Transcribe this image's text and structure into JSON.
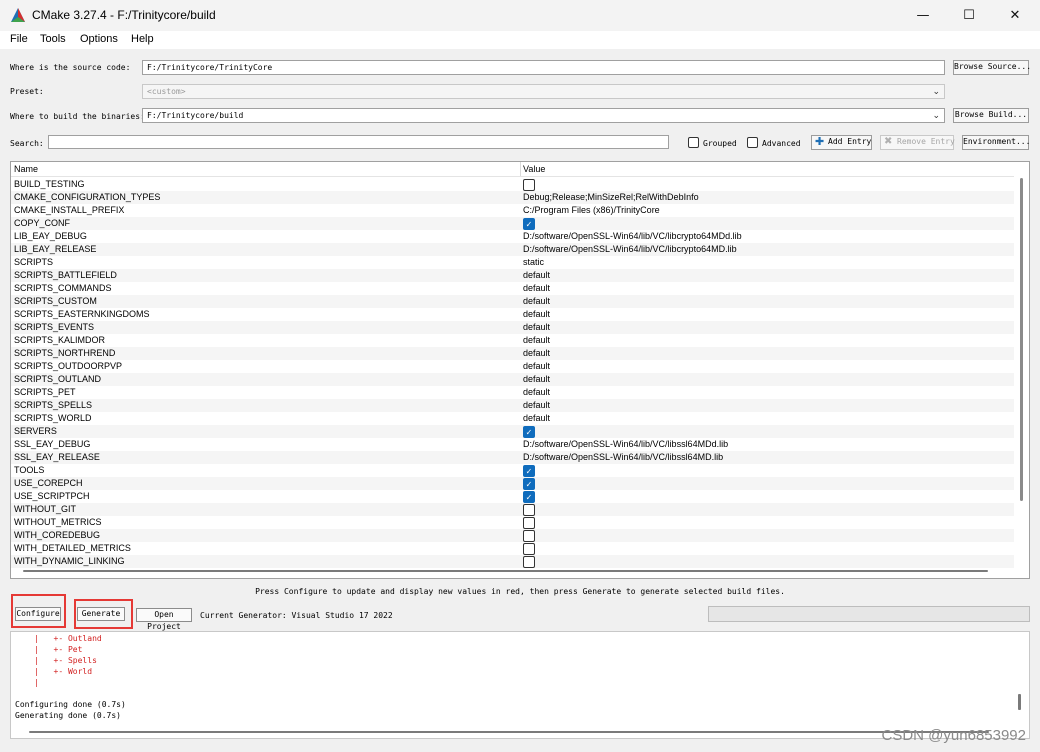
{
  "window": {
    "title": "CMake 3.27.4 - F:/Trinitycore/build",
    "minimize": "—",
    "maximize": "☐",
    "close": "✕"
  },
  "menu": [
    "File",
    "Tools",
    "Options",
    "Help"
  ],
  "source": {
    "label": "Where is the source code:",
    "value": "F:/Trinitycore/TrinityCore",
    "browse": "Browse Source..."
  },
  "preset": {
    "label": "Preset:",
    "value": "<custom>"
  },
  "binaries": {
    "label": "Where to build the binaries:",
    "value": "F:/Trinitycore/build",
    "browse": "Browse Build..."
  },
  "search": {
    "label": "Search:",
    "value": "",
    "grouped": "Grouped",
    "advanced": "Advanced",
    "add_entry": "Add Entry",
    "remove_entry": "Remove Entry",
    "environment": "Environment..."
  },
  "table": {
    "columns": [
      "Name",
      "Value"
    ],
    "rows": [
      {
        "name": "BUILD_TESTING",
        "type": "bool",
        "checked": false
      },
      {
        "name": "CMAKE_CONFIGURATION_TYPES",
        "type": "text",
        "value": "Debug;Release;MinSizeRel;RelWithDebInfo"
      },
      {
        "name": "CMAKE_INSTALL_PREFIX",
        "type": "text",
        "value": "C:/Program Files (x86)/TrinityCore"
      },
      {
        "name": "COPY_CONF",
        "type": "bool",
        "checked": true
      },
      {
        "name": "LIB_EAY_DEBUG",
        "type": "text",
        "value": "D:/software/OpenSSL-Win64/lib/VC/libcrypto64MDd.lib"
      },
      {
        "name": "LIB_EAY_RELEASE",
        "type": "text",
        "value": "D:/software/OpenSSL-Win64/lib/VC/libcrypto64MD.lib"
      },
      {
        "name": "SCRIPTS",
        "type": "text",
        "value": "static"
      },
      {
        "name": "SCRIPTS_BATTLEFIELD",
        "type": "text",
        "value": "default"
      },
      {
        "name": "SCRIPTS_COMMANDS",
        "type": "text",
        "value": "default"
      },
      {
        "name": "SCRIPTS_CUSTOM",
        "type": "text",
        "value": "default"
      },
      {
        "name": "SCRIPTS_EASTERNKINGDOMS",
        "type": "text",
        "value": "default"
      },
      {
        "name": "SCRIPTS_EVENTS",
        "type": "text",
        "value": "default"
      },
      {
        "name": "SCRIPTS_KALIMDOR",
        "type": "text",
        "value": "default"
      },
      {
        "name": "SCRIPTS_NORTHREND",
        "type": "text",
        "value": "default"
      },
      {
        "name": "SCRIPTS_OUTDOORPVP",
        "type": "text",
        "value": "default"
      },
      {
        "name": "SCRIPTS_OUTLAND",
        "type": "text",
        "value": "default"
      },
      {
        "name": "SCRIPTS_PET",
        "type": "text",
        "value": "default"
      },
      {
        "name": "SCRIPTS_SPELLS",
        "type": "text",
        "value": "default"
      },
      {
        "name": "SCRIPTS_WORLD",
        "type": "text",
        "value": "default"
      },
      {
        "name": "SERVERS",
        "type": "bool",
        "checked": true
      },
      {
        "name": "SSL_EAY_DEBUG",
        "type": "text",
        "value": "D:/software/OpenSSL-Win64/lib/VC/libssl64MDd.lib"
      },
      {
        "name": "SSL_EAY_RELEASE",
        "type": "text",
        "value": "D:/software/OpenSSL-Win64/lib/VC/libssl64MD.lib"
      },
      {
        "name": "TOOLS",
        "type": "bool",
        "checked": true
      },
      {
        "name": "USE_COREPCH",
        "type": "bool",
        "checked": true
      },
      {
        "name": "USE_SCRIPTPCH",
        "type": "bool",
        "checked": true
      },
      {
        "name": "WITHOUT_GIT",
        "type": "bool",
        "checked": false
      },
      {
        "name": "WITHOUT_METRICS",
        "type": "bool",
        "checked": false
      },
      {
        "name": "WITH_COREDEBUG",
        "type": "bool",
        "checked": false
      },
      {
        "name": "WITH_DETAILED_METRICS",
        "type": "bool",
        "checked": false
      },
      {
        "name": "WITH_DYNAMIC_LINKING",
        "type": "bool",
        "checked": false
      }
    ]
  },
  "hint": "Press Configure to update and display new values in red, then press Generate to generate selected build files.",
  "actions": {
    "configure": "Configure",
    "generate": "Generate",
    "open_project": "Open Project",
    "generator": "Current Generator: Visual Studio 17 2022"
  },
  "output": [
    {
      "text": "    |   +- Outland",
      "red": true
    },
    {
      "text": "    |   +- Pet",
      "red": true
    },
    {
      "text": "    |   +- Spells",
      "red": true
    },
    {
      "text": "    |   +- World",
      "red": true
    },
    {
      "text": "    |",
      "red": true
    },
    {
      "text": "",
      "red": false
    },
    {
      "text": "Configuring done (0.7s)",
      "red": false
    },
    {
      "text": "Generating done (0.7s)",
      "red": false
    }
  ],
  "watermark": "CSDN @yun6853992",
  "colors": {
    "accent": "#0f6cbd",
    "highlight": "#e53935",
    "log_red": "#d21f1f"
  }
}
